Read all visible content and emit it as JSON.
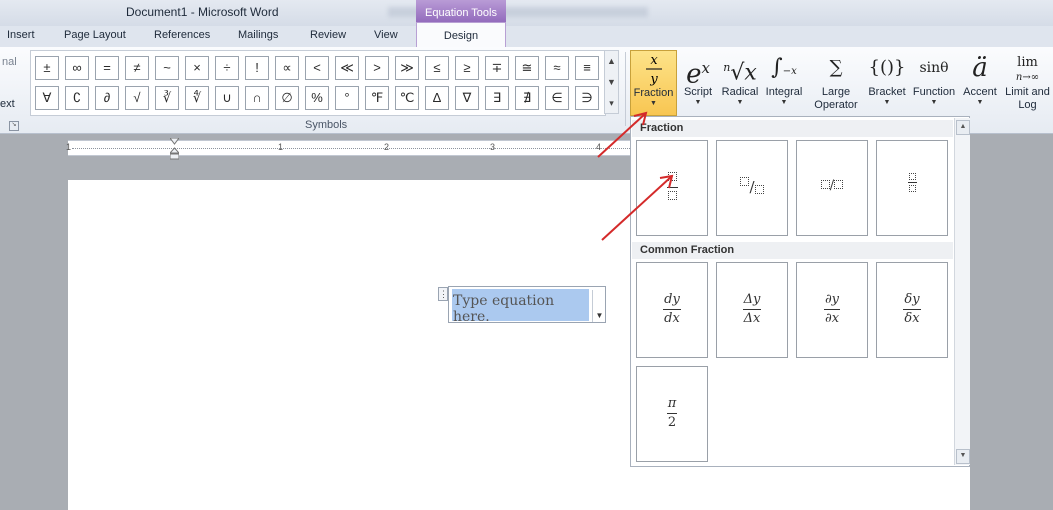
{
  "window": {
    "title": "Document1 - Microsoft Word"
  },
  "contextual": {
    "group_label": "Equation Tools",
    "tab": "Design"
  },
  "tabs": [
    "Insert",
    "Page Layout",
    "References",
    "Mailings",
    "Review",
    "View"
  ],
  "left_fragments": {
    "top": "nal",
    "bottom": "ext"
  },
  "symbols": {
    "group_label": "Symbols",
    "row1": [
      "±",
      "∞",
      "=",
      "≠",
      "~",
      "×",
      "÷",
      "!",
      "∝",
      "<",
      "≪",
      ">",
      "≫",
      "≤",
      "≥",
      "∓",
      "≅",
      "≈",
      "≡"
    ],
    "row2": [
      "∀",
      "∁",
      "∂",
      "√",
      "∛",
      "∜",
      "∪",
      "∩",
      "∅",
      "%",
      "°",
      "℉",
      "℃",
      "∆",
      "∇",
      "∃",
      "∄",
      "∈",
      "∋"
    ]
  },
  "structures": [
    {
      "id": "fraction",
      "label": "Fraction",
      "icon": "x/y"
    },
    {
      "id": "script",
      "label": "Script",
      "icon": "e^x"
    },
    {
      "id": "radical",
      "label": "Radical",
      "icon": "ⁿ√x"
    },
    {
      "id": "integral",
      "label": "Integral",
      "icon": "∫₋ₓˣ"
    },
    {
      "id": "large-operator",
      "label": "Large\nOperator",
      "icon": "Σ"
    },
    {
      "id": "bracket",
      "label": "Bracket",
      "icon": "{()}"
    },
    {
      "id": "function",
      "label": "Function",
      "icon": "sinθ"
    },
    {
      "id": "accent",
      "label": "Accent",
      "icon": "ä"
    },
    {
      "id": "limit-and-log",
      "label": "Limit and\nLog",
      "icon": "lim n→∞"
    }
  ],
  "ruler": {
    "numbers": [
      "1",
      "1",
      "2",
      "3",
      "4"
    ]
  },
  "equation": {
    "placeholder": "Type equation here."
  },
  "dropdown": {
    "section_fraction": "Fraction",
    "section_common": "Common Fraction",
    "common": [
      {
        "num": "dy",
        "den": "dx"
      },
      {
        "num": "Δy",
        "den": "Δx"
      },
      {
        "num": "∂y",
        "den": "∂x"
      },
      {
        "num": "δy",
        "den": "δx"
      },
      {
        "num": "π",
        "den": "2"
      }
    ]
  },
  "colors": {
    "accent": "#8c63b8",
    "annotation": "#d42a2a",
    "highlight": "#f8c652"
  }
}
